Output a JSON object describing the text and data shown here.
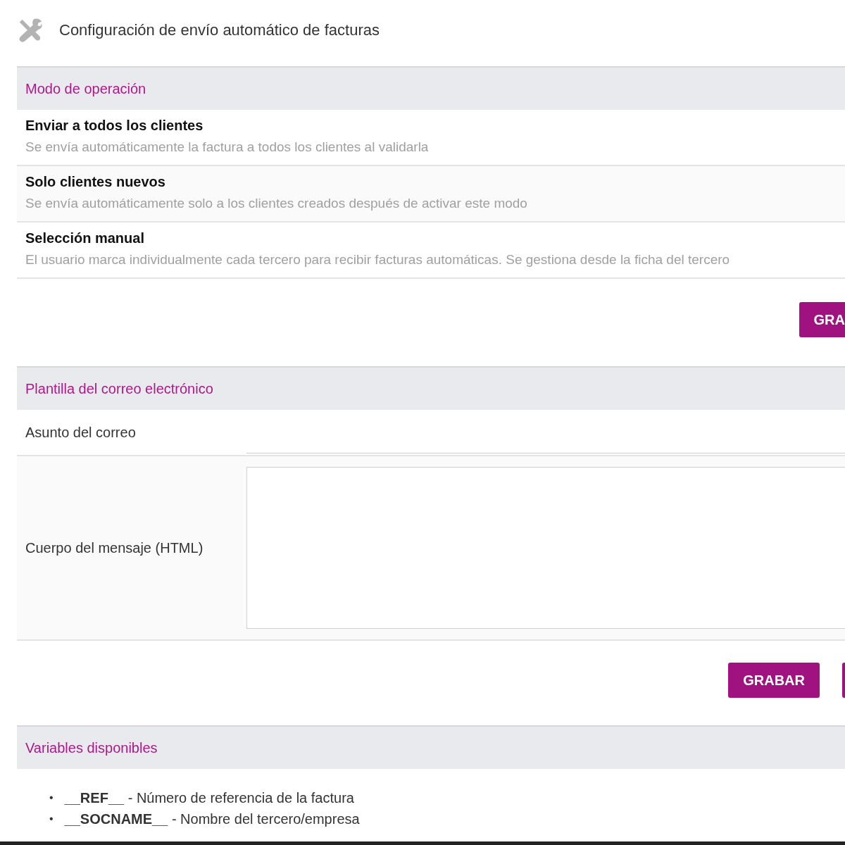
{
  "page": {
    "title": "Configuración de envío automático de facturas"
  },
  "sections": [
    {
      "kind": "modes",
      "title": "Modo de operación",
      "options": [
        {
          "name": "Enviar a todos los clientes",
          "description": "Se envía automáticamente la factura a todos los clientes al validarla"
        },
        {
          "name": "Solo clientes nuevos",
          "description": "Se envía automáticamente solo a los clientes creados después de activar este modo"
        },
        {
          "name": "Selección manual",
          "description": "El usuario marca individualmente cada tercero para recibir facturas automáticas. Se gestiona desde la ficha del tercero"
        }
      ],
      "buttons": [
        {
          "kind": "button",
          "label": "GRA"
        }
      ]
    },
    {
      "kind": "form",
      "title": "Plantilla del correo electrónico",
      "fields": [
        {
          "kind": "input",
          "label": "Asunto del correo"
        },
        {
          "kind": "textarea",
          "label": "Cuerpo del mensaje (HTML)"
        }
      ],
      "buttons": [
        {
          "kind": "button",
          "label": "GRABAR"
        },
        {
          "kind": "edge"
        }
      ]
    },
    {
      "kind": "list",
      "title": "Variables disponibles",
      "items": [
        {
          "bullet": "•",
          "text": "**__REF__** - Número de referencia de la factura"
        },
        {
          "bullet": "•",
          "text": "**__SOCNAME__** - Nombre del tercero/empresa"
        }
      ]
    }
  ]
}
